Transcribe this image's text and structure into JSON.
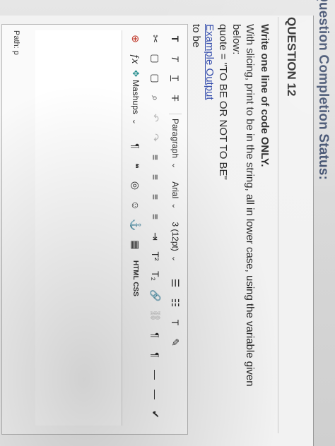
{
  "header": {
    "status_title": "Question Completion Status:"
  },
  "question": {
    "title": "QUESTION 12",
    "lines": [
      "Write one line of code ONLY.",
      "With slicing, print to be in the string, all in lower case, using the variable given below:",
      "quote = \"TO BE OR NOT TO BE\"",
      "Example Output",
      "to be"
    ]
  },
  "editor": {
    "row1": {
      "bold": "T",
      "italic": "T",
      "underline": "T",
      "strike": "T",
      "paragraph_select": "Paragraph",
      "font_select": "Arial",
      "size_select": "3 (12pt)",
      "chevron": "⌄",
      "ul": "☰",
      "ol": "☷",
      "textcolor": "T",
      "marker": "✎"
    },
    "row2": {
      "cut": "✂",
      "copy": "▢",
      "paste": "▢",
      "find": "⌕",
      "undo": "↶",
      "redo": "↷",
      "align_left": "≡",
      "align_center": "≡",
      "align_right": "≡",
      "justify": "≡",
      "indent": "⇥",
      "sup": "T²",
      "sub": "T₂",
      "link": "🔗",
      "unlink": "⛓",
      "ltr": "¶",
      "rtl": "¶",
      "hr": "—",
      "minus": "—",
      "spellcheck": "✔"
    },
    "row3": {
      "add_content": "⊕",
      "fx": "ƒx",
      "mashups": "Mashups",
      "pilcrow": "¶",
      "quote": "❝",
      "circle": "◎",
      "smiley": "☺",
      "anchor": "⚓",
      "table": "▦",
      "html_css": "HTML CSS"
    },
    "path_label": "Path:",
    "path_value": "p"
  }
}
